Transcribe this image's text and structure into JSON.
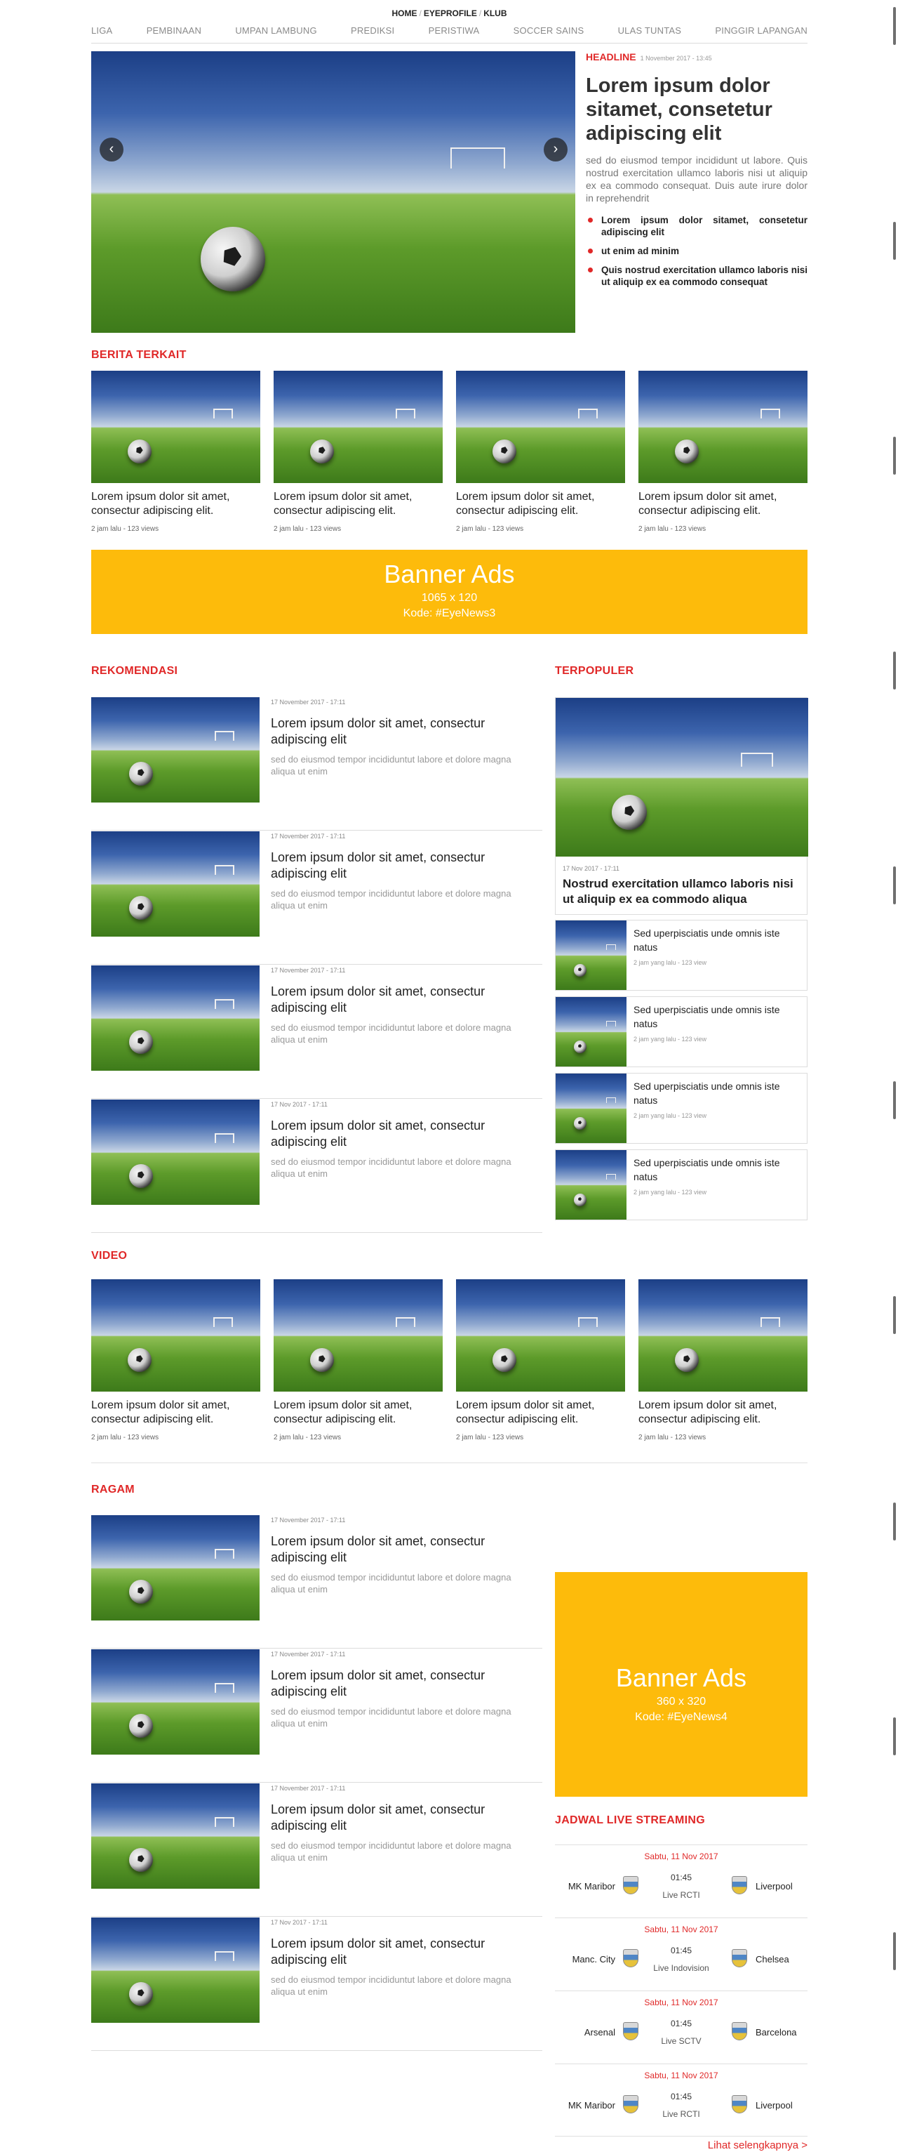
{
  "breadcrumb": [
    "HOME",
    "EYEPROFILE",
    "KLUB"
  ],
  "nav": [
    "LIGA",
    "PEMBINAAN",
    "UMPAN LAMBUNG",
    "PREDIKSI",
    "PERISTIWA",
    "SOCCER SAINS",
    "ULAS TUNTAS",
    "PINGGIR LAPANGAN"
  ],
  "headline": {
    "kicker": "HEADLINE",
    "date": "1 November 2017 - 13:45",
    "title": "Lorem ipsum dolor sitamet, consetetur adipiscing elit",
    "lead": "sed do eiusmod tempor incididunt ut labore. Quis nostrud exercitation ullamco laboris nisi ut aliquip ex ea commodo consequat. Duis aute irure dolor in reprehendrit",
    "bullets": [
      "Lorem ipsum dolor sitamet, consetetur adipiscing elit",
      "ut enim ad minim",
      "Quis nostrud exercitation ullamco laboris nisi ut aliquip ex ea commodo consequat"
    ],
    "prev_icon": "‹",
    "next_icon": "›"
  },
  "berita_terkait": {
    "title": "BERITA TERKAIT",
    "items": [
      {
        "title": "Lorem ipsum dolor sit amet, consectur adipiscing elit.",
        "meta": "2 jam lalu - 123 views"
      },
      {
        "title": "Lorem ipsum dolor sit amet, consectur adipiscing elit.",
        "meta": "2 jam lalu - 123 views"
      },
      {
        "title": "Lorem ipsum dolor sit amet, consectur adipiscing elit.",
        "meta": "2 jam lalu - 123 views"
      },
      {
        "title": "Lorem ipsum dolor sit amet, consectur adipiscing elit.",
        "meta": "2 jam lalu - 123 views"
      }
    ]
  },
  "banner1": {
    "title": "Banner Ads",
    "size": "1065 x 120",
    "code": "Kode: #EyeNews3"
  },
  "rekomendasi": {
    "title": "REKOMENDASI",
    "items": [
      {
        "date": "17 November 2017 - 17:11",
        "title": "Lorem ipsum dolor sit amet, consectur adipiscing elit",
        "excerpt": "sed do eiusmod tempor incididuntut labore et dolore magna aliqua ut enim"
      },
      {
        "date": "17 November 2017 - 17:11",
        "title": "Lorem ipsum dolor sit amet, consectur adipiscing elit",
        "excerpt": "sed do eiusmod tempor incididuntut labore et dolore magna aliqua ut enim"
      },
      {
        "date": "17 November 2017 - 17:11",
        "title": "Lorem ipsum dolor sit amet, consectur adipiscing elit",
        "excerpt": "sed do eiusmod tempor incididuntut labore et dolore magna aliqua ut enim"
      },
      {
        "date": "17 Nov 2017 - 17:11",
        "title": "Lorem ipsum dolor sit amet, consectur adipiscing elit",
        "excerpt": "sed do eiusmod tempor incididuntut labore et dolore magna aliqua ut enim"
      }
    ]
  },
  "terpopuler": {
    "title": "TERPOPULER",
    "main": {
      "date": "17 Nov 2017 - 17:11",
      "title": "Nostrud exercitation ullamco laboris nisi ut aliquip ex ea commodo aliqua"
    },
    "items": [
      {
        "title": "Sed uperpisciatis unde omnis iste natus",
        "meta": "2 jam yang lalu - 123 view"
      },
      {
        "title": "Sed uperpisciatis unde omnis iste natus",
        "meta": "2 jam yang lalu - 123 view"
      },
      {
        "title": "Sed uperpisciatis unde omnis iste natus",
        "meta": "2 jam yang lalu - 123 view"
      },
      {
        "title": "Sed uperpisciatis unde omnis iste natus",
        "meta": "2 jam yang lalu - 123 view"
      }
    ]
  },
  "video": {
    "title": "VIDEO",
    "items": [
      {
        "title": "Lorem ipsum dolor sit amet, consectur adipiscing elit.",
        "meta": "2 jam lalu - 123 views"
      },
      {
        "title": "Lorem ipsum dolor sit amet, consectur adipiscing elit.",
        "meta": "2 jam lalu - 123 views"
      },
      {
        "title": "Lorem ipsum dolor sit amet, consectur adipiscing elit.",
        "meta": "2 jam lalu - 123 views"
      },
      {
        "title": "Lorem ipsum dolor sit amet, consectur adipiscing elit.",
        "meta": "2 jam lalu - 123 views"
      }
    ]
  },
  "ragam": {
    "title": "RAGAM",
    "items": [
      {
        "date": "17 November 2017 - 17:11",
        "title": "Lorem ipsum dolor sit amet, consectur adipiscing elit",
        "excerpt": "sed do eiusmod tempor incididuntut labore et dolore magna aliqua ut enim"
      },
      {
        "date": "17 November 2017 - 17:11",
        "title": "Lorem ipsum dolor sit amet, consectur adipiscing elit",
        "excerpt": "sed do eiusmod tempor incididuntut labore et dolore magna aliqua ut enim"
      },
      {
        "date": "17 November 2017 - 17:11",
        "title": "Lorem ipsum dolor sit amet, consectur adipiscing elit",
        "excerpt": "sed do eiusmod tempor incididuntut labore et dolore magna aliqua ut enim"
      },
      {
        "date": "17 Nov 2017 - 17:11",
        "title": "Lorem ipsum dolor sit amet, consectur adipiscing elit",
        "excerpt": "sed do eiusmod tempor incididuntut labore et dolore magna aliqua ut enim"
      }
    ]
  },
  "banner2": {
    "title": "Banner Ads",
    "size": "360 x 320",
    "code": "Kode: #EyeNews4"
  },
  "jadwal": {
    "title": "JADWAL LIVE STREAMING",
    "matches": [
      {
        "date": "Sabtu, 11 Nov 2017",
        "time": "01:45",
        "channel": "Live RCTI",
        "home": "MK Maribor",
        "away": "Liverpool"
      },
      {
        "date": "Sabtu, 11 Nov 2017",
        "time": "01:45",
        "channel": "Live Indovision",
        "home": "Manc. City",
        "away": "Chelsea"
      },
      {
        "date": "Sabtu, 11 Nov 2017",
        "time": "01:45",
        "channel": "Live SCTV",
        "home": "Arsenal",
        "away": "Barcelona"
      },
      {
        "date": "Sabtu, 11 Nov 2017",
        "time": "01:45",
        "channel": "Live RCTI",
        "home": "MK Maribor",
        "away": "Liverpool"
      }
    ],
    "see_more": "Lihat selengkapnya >"
  },
  "colors": {
    "accent": "#e02828",
    "banner": "#fdbb0b"
  }
}
